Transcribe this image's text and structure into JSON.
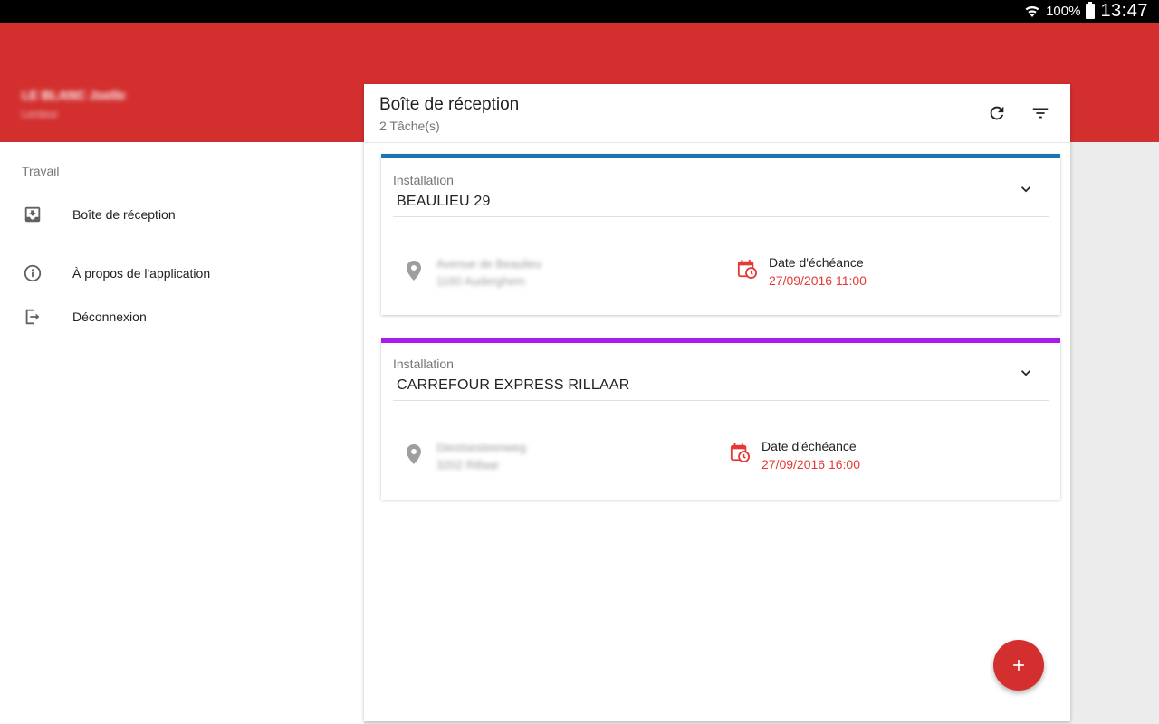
{
  "status_bar": {
    "battery": "100%",
    "time": "13:47"
  },
  "user": {
    "name": "LE BLANC Joelle",
    "subtitle": "Lecteur"
  },
  "drawer": {
    "section": "Travail",
    "items": [
      {
        "label": "Boîte de réception",
        "icon": "inbox-icon"
      },
      {
        "label": "À propos de l'application",
        "icon": "info-icon"
      },
      {
        "label": "Déconnexion",
        "icon": "logout-icon"
      }
    ]
  },
  "main": {
    "title": "Boîte de réception",
    "subtitle": "2 Tâche(s)",
    "tasks": [
      {
        "label": "Installation",
        "name": "BEAULIEU 29",
        "stripe_color": "#1976b5",
        "address_line1": "Avenue de Beaulieu",
        "address_line2": "1160 Auderghem",
        "due_label": "Date d'échéance",
        "due_date": "27/09/2016 11:00"
      },
      {
        "label": "Installation",
        "name": "CARREFOUR EXPRESS RILLAAR",
        "stripe_color": "#aa1de8",
        "address_line1": "Diestsesteenweg",
        "address_line2": "3202 Rillaar",
        "due_label": "Date d'échéance",
        "due_date": "27/09/2016 16:00"
      }
    ]
  },
  "colors": {
    "primary": "#d32f2f",
    "due_date": "#e53935"
  }
}
